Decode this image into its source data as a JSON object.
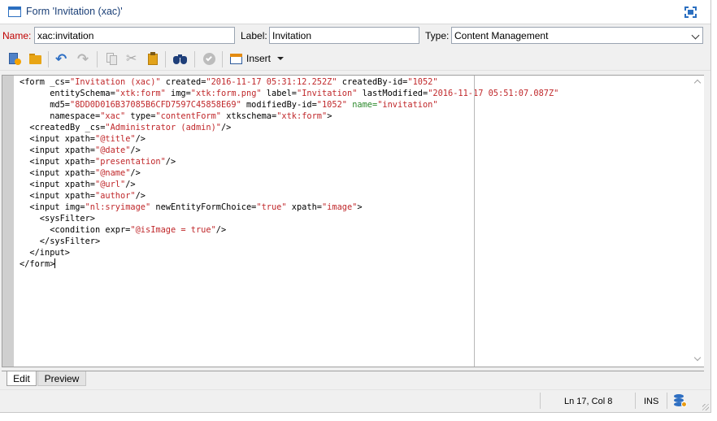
{
  "window": {
    "title": "Form 'Invitation (xac)'"
  },
  "fields": {
    "name_label": "Name:",
    "name_value": "xac:invitation",
    "label_label": "Label:",
    "label_value": "Invitation",
    "type_label": "Type:",
    "type_value": "Content Management"
  },
  "toolbar": {
    "insert_label": "Insert"
  },
  "editor": {
    "lines": [
      [
        [
          "t",
          "<form _cs="
        ],
        [
          "s",
          "\"Invitation (xac)\""
        ],
        [
          "t",
          " created="
        ],
        [
          "s",
          "\"2016-11-17 05:31:12.252Z\""
        ],
        [
          "t",
          " createdBy-id="
        ],
        [
          "s",
          "\"1052\""
        ]
      ],
      [
        [
          "t",
          "      entitySchema="
        ],
        [
          "s",
          "\"xtk:form\""
        ],
        [
          "t",
          " img="
        ],
        [
          "s",
          "\"xtk:form.png\""
        ],
        [
          "t",
          " label="
        ],
        [
          "s",
          "\"Invitation\""
        ],
        [
          "t",
          " lastModified="
        ],
        [
          "s",
          "\"2016-11-17 05:51:07.087Z\""
        ]
      ],
      [
        [
          "t",
          "      md5="
        ],
        [
          "s",
          "\"8DD0D016B37085B6CFD7597C45858E69\""
        ],
        [
          "t",
          " modifiedBy-id="
        ],
        [
          "s",
          "\"1052\""
        ],
        [
          "t",
          " "
        ],
        [
          "g",
          "name="
        ],
        [
          "s",
          "\"invitation\""
        ]
      ],
      [
        [
          "t",
          "      namespace="
        ],
        [
          "s",
          "\"xac\""
        ],
        [
          "t",
          " type="
        ],
        [
          "s",
          "\"contentForm\""
        ],
        [
          "t",
          " xtkschema="
        ],
        [
          "s",
          "\"xtk:form\""
        ],
        [
          "t",
          ">"
        ]
      ],
      [
        [
          "t",
          "  <createdBy _cs="
        ],
        [
          "s",
          "\"Administrator (admin)\""
        ],
        [
          "t",
          "/>"
        ]
      ],
      [
        [
          "t",
          "  <input xpath="
        ],
        [
          "s",
          "\"@title\""
        ],
        [
          "t",
          "/>"
        ]
      ],
      [
        [
          "t",
          "  <input xpath="
        ],
        [
          "s",
          "\"@date\""
        ],
        [
          "t",
          "/>"
        ]
      ],
      [
        [
          "t",
          "  <input xpath="
        ],
        [
          "s",
          "\"presentation\""
        ],
        [
          "t",
          "/>"
        ]
      ],
      [
        [
          "t",
          "  <input xpath="
        ],
        [
          "s",
          "\"@name\""
        ],
        [
          "t",
          "/>"
        ]
      ],
      [
        [
          "t",
          "  <input xpath="
        ],
        [
          "s",
          "\"@url\""
        ],
        [
          "t",
          "/>"
        ]
      ],
      [
        [
          "t",
          "  <input xpath="
        ],
        [
          "s",
          "\"author\""
        ],
        [
          "t",
          "/>"
        ]
      ],
      [
        [
          "t",
          "  <input img="
        ],
        [
          "s",
          "\"nl:sryimage\""
        ],
        [
          "t",
          " newEntityFormChoice="
        ],
        [
          "s",
          "\"true\""
        ],
        [
          "t",
          " xpath="
        ],
        [
          "s",
          "\"image\""
        ],
        [
          "t",
          ">"
        ]
      ],
      [
        [
          "t",
          "    <sysFilter>"
        ]
      ],
      [
        [
          "t",
          "      <condition expr="
        ],
        [
          "s",
          "\"@isImage = true\""
        ],
        [
          "t",
          "/>"
        ]
      ],
      [
        [
          "t",
          "    </sysFilter>"
        ]
      ],
      [
        [
          "t",
          "  </input>"
        ]
      ],
      [
        [
          "t",
          "</form>"
        ]
      ]
    ]
  },
  "tabs": {
    "edit": "Edit",
    "preview": "Preview"
  },
  "status": {
    "position": "Ln 17, Col 8",
    "mode": "INS"
  },
  "icons": {
    "window": "form-window-icon",
    "maximize": "maximize-icon",
    "new": "new-document-icon",
    "open": "open-folder-icon",
    "undo": "undo-icon",
    "redo": "redo-icon",
    "copy": "copy-icon",
    "cut": "cut-icon",
    "paste": "paste-icon",
    "find": "binoculars-icon",
    "check": "check-icon",
    "insert": "insert-icon",
    "database": "database-icon"
  },
  "colors": {
    "string": "#c0282b",
    "attribute_highlight": "#2d8a2d",
    "accent": "#2b6fc0",
    "name_label": "#c00000"
  }
}
